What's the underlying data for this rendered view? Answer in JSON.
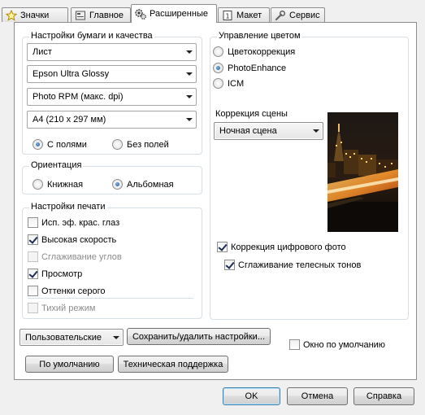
{
  "tabs": [
    {
      "label": "Значки",
      "icon": "star-icon"
    },
    {
      "label": "Главное",
      "icon": "main-settings-icon"
    },
    {
      "label": "Расширенные",
      "icon": "gears-icon",
      "active": true
    },
    {
      "label": "Макет",
      "icon": "layout-page-icon"
    },
    {
      "label": "Сервис",
      "icon": "wrench-icon"
    }
  ],
  "paper": {
    "title": "Настройки бумаги и качества",
    "source": "Лист",
    "media_type": "Epson Ultra Glossy",
    "quality": "Photo RPM (макс. dpi)",
    "size": "A4 (210 x 297 мм)",
    "with_margins": "С полями",
    "borderless": "Без полей",
    "selected": "with_margins"
  },
  "orientation": {
    "title": "Ориентация",
    "portrait": "Книжная",
    "landscape": "Альбомная",
    "selected": "landscape"
  },
  "print_settings": {
    "title": "Настройки печати",
    "items": [
      {
        "label": "Исп. эф. крас. глаз",
        "checked": false,
        "enabled": true
      },
      {
        "label": "Высокая скорость",
        "checked": true,
        "enabled": true
      },
      {
        "label": "Сглаживание углов",
        "checked": false,
        "enabled": false
      },
      {
        "label": "Просмотр",
        "checked": true,
        "enabled": true
      },
      {
        "label": "Оттенки серого",
        "checked": false,
        "enabled": true
      },
      {
        "label": "Тихий режим",
        "checked": false,
        "enabled": false
      }
    ]
  },
  "color": {
    "title": "Управление цветом",
    "options": [
      "Цветокоррекция",
      "PhotoEnhance",
      "ICM"
    ],
    "selected": "PhotoEnhance",
    "scene_label": "Коррекция сцены",
    "scene_value": "Ночная сцена",
    "digital_photo": "Коррекция цифрового фото",
    "digital_photo_checked": true,
    "skin_tones": "Сглаживание телесных тонов",
    "skin_tones_checked": true
  },
  "footer": {
    "preset": "Пользовательские",
    "save_delete": "Сохранить/удалить настройки...",
    "default_window": "Окно по умолчанию",
    "defaults": "По умолчанию",
    "support": "Техническая поддержка"
  },
  "dialog": {
    "ok": "OK",
    "cancel": "Отмена",
    "help": "Справка"
  }
}
